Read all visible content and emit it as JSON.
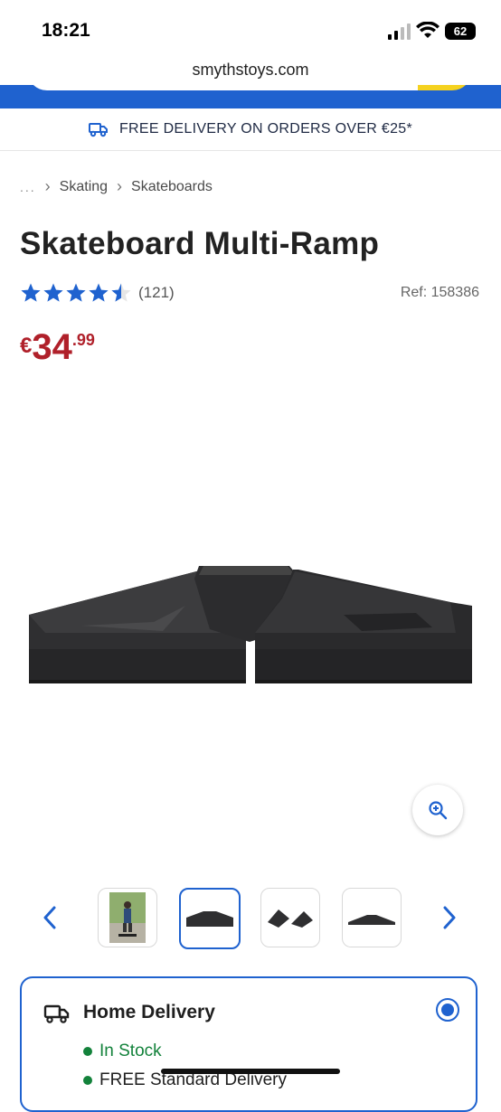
{
  "status_bar": {
    "time": "18:21",
    "battery": "62"
  },
  "browser": {
    "url": "smythstoys.com"
  },
  "banner": {
    "text": "FREE DELIVERY ON ORDERS OVER €25*"
  },
  "breadcrumb": {
    "ellipsis": "...",
    "items": [
      "Skating",
      "Skateboards"
    ]
  },
  "product": {
    "title": "Skateboard Multi-Ramp",
    "rating": 4.5,
    "review_count": "(121)",
    "ref": "Ref: 158386",
    "price": {
      "currency": "€",
      "main": "34",
      "cents": ".99"
    }
  },
  "gallery": {
    "thumbnails": [
      {
        "label": "skater-photo"
      },
      {
        "label": "ramp-front",
        "active": true
      },
      {
        "label": "ramp-pair"
      },
      {
        "label": "ramp-side"
      }
    ]
  },
  "delivery": {
    "title": "Home Delivery",
    "stock": "In Stock",
    "standard": "FREE Standard Delivery"
  },
  "colors": {
    "brand_blue": "#1f62cf",
    "price_red": "#b0202a",
    "stock_green": "#13823b",
    "accent_yellow": "#f5d21f"
  }
}
